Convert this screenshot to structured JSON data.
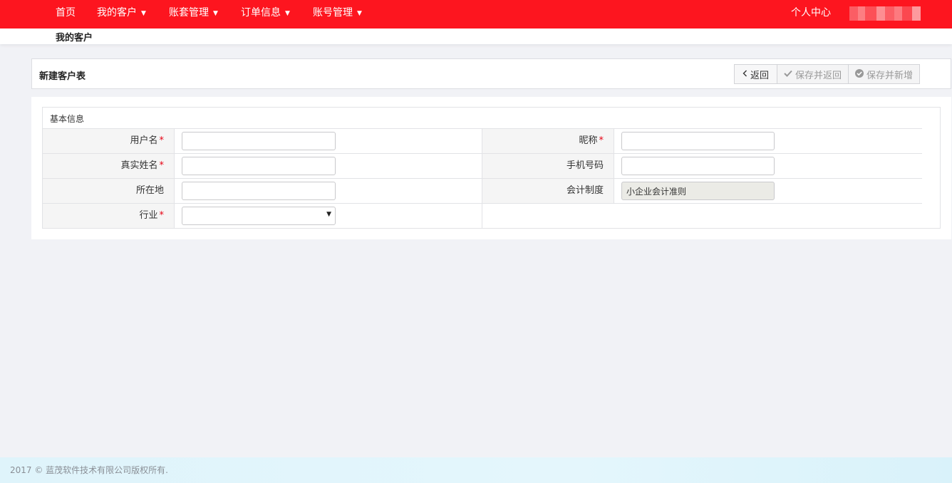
{
  "topnav": {
    "items": [
      {
        "label": "首页"
      },
      {
        "label": "我的客户",
        "caret": "▼"
      },
      {
        "label": "账套管理",
        "caret": "▼"
      },
      {
        "label": "订单信息",
        "caret": "▼"
      },
      {
        "label": "账号管理",
        "caret": "▼"
      }
    ],
    "personal_center": "个人中心",
    "bg_color": "#fd151f"
  },
  "breadcrumb": {
    "current": "我的客户"
  },
  "form": {
    "title": "新建客户表",
    "buttons": {
      "back": "返回",
      "save_return": "保存并返回",
      "save_new": "保存并新增"
    },
    "section_title": "基本信息",
    "fields": {
      "username": {
        "label": "用户名",
        "required": "*",
        "value": ""
      },
      "nickname": {
        "label": "昵称",
        "required": "*",
        "value": ""
      },
      "realname": {
        "label": "真实姓名",
        "required": "*",
        "value": ""
      },
      "phone": {
        "label": "手机号码",
        "value": ""
      },
      "location": {
        "label": "所在地",
        "value": ""
      },
      "accounting": {
        "label": "会计制度",
        "value": "小企业会计准则"
      },
      "industry": {
        "label": "行业",
        "required": "*",
        "value": ""
      }
    }
  },
  "footer": {
    "copyright": "2017 © 蓝茂软件技术有限公司版权所有."
  }
}
